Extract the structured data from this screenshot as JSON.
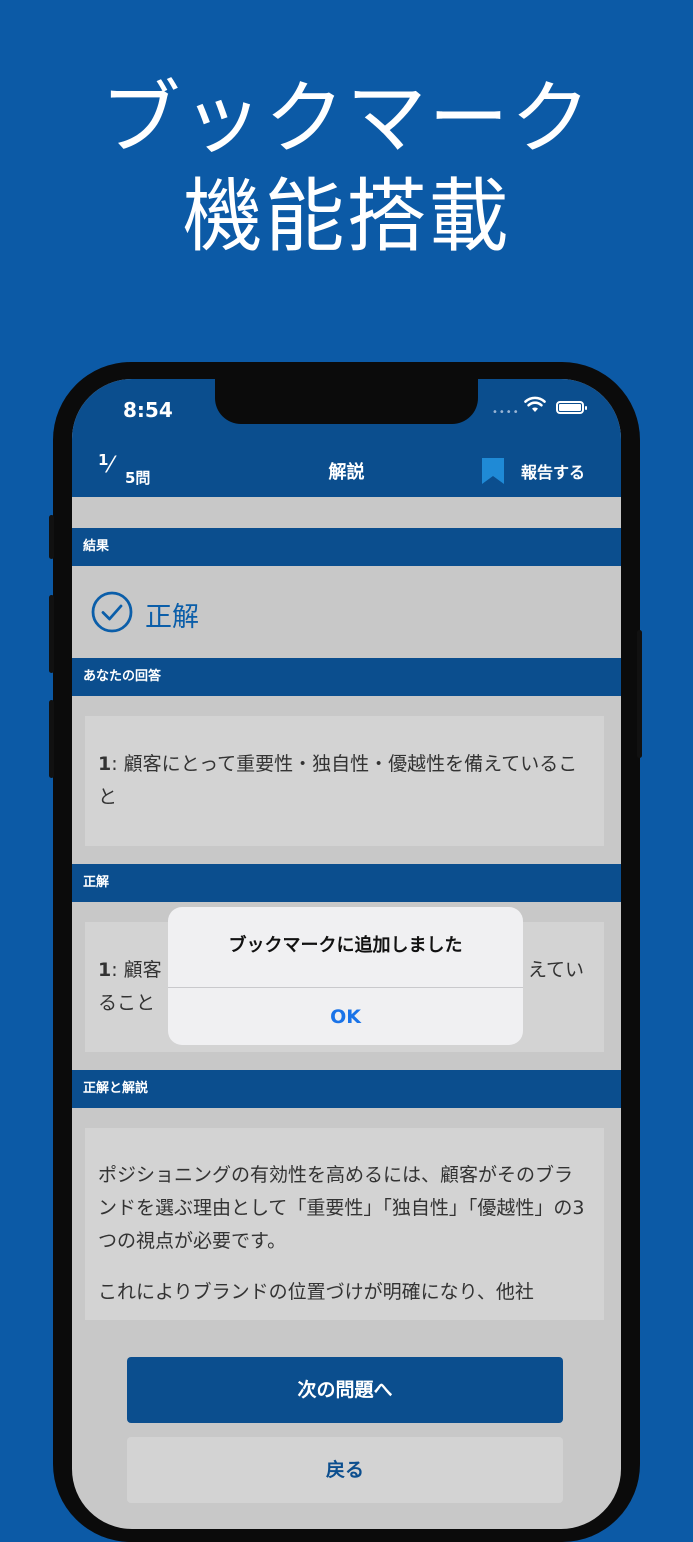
{
  "promo": {
    "line1": "ブックマーク",
    "line2": "機能搭載"
  },
  "status_bar": {
    "time": "8:54",
    "signal_dots": "••••",
    "wifi_icon": "wifi-icon",
    "battery_icon": "battery-icon"
  },
  "nav": {
    "counter_current": "1",
    "counter_total": "5問",
    "title": "解説",
    "bookmark_icon": "bookmark-icon",
    "report": "報告する"
  },
  "sections": {
    "result_header": "結果",
    "result_text": "正解",
    "your_answer_header": "あなたの回答",
    "your_answer_num": "1",
    "your_answer_text": ": 顧客にとって重要性・独自性・優越性を備えていること",
    "correct_header": "正解",
    "correct_num": "1",
    "correct_text_left": ": 顧客",
    "correct_text_right": "えてい",
    "correct_text_line2": "ること",
    "explanation_header": "正解と解説",
    "explanation_p1": "ポジショニングの有効性を高めるには、顧客がそのブランドを選ぶ理由として「重要性」「独自性」「優越性」の3つの視点が必要です。",
    "explanation_p2": "これによりブランドの位置づけが明確になり、他社"
  },
  "buttons": {
    "next": "次の問題へ",
    "back": "戻る"
  },
  "alert": {
    "message": "ブックマークに追加しました",
    "ok": "OK"
  },
  "colors": {
    "background": "#0c5aa6",
    "header_blue": "#0b4e8e",
    "accent": "#0b5ea9",
    "alert_button": "#1a73e8"
  }
}
